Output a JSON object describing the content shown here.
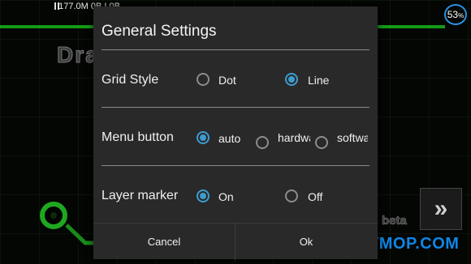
{
  "status_bar": {
    "memory_text": "177.0M 0B I 0B",
    "battery_value": "53",
    "battery_unit": "%"
  },
  "background": {
    "title_fragment": "Dra",
    "beta_label": "beta",
    "forward_button_label": "»"
  },
  "dialog": {
    "title": "General Settings",
    "rows": [
      {
        "label": "Grid Style",
        "options": [
          {
            "label": "Dot",
            "checked": false
          },
          {
            "label": "Line",
            "checked": true
          }
        ]
      },
      {
        "label": "Menu button",
        "options": [
          {
            "label": "auto",
            "checked": true
          },
          {
            "label": "hardware",
            "checked": false
          },
          {
            "label": "software",
            "checked": false
          }
        ]
      },
      {
        "label": "Layer marker",
        "options": [
          {
            "label": "On",
            "checked": true
          },
          {
            "label": "Off",
            "checked": false
          }
        ]
      }
    ],
    "cancel_label": "Cancel",
    "ok_label": "Ok"
  },
  "watermark": "ITMOP.COM",
  "colors": {
    "accent": "#3d9ccf",
    "dialog_bg": "#292929",
    "background_line": "#19b519",
    "watermark": "#0f86e6",
    "battery_ring": "#2d8fe0"
  }
}
